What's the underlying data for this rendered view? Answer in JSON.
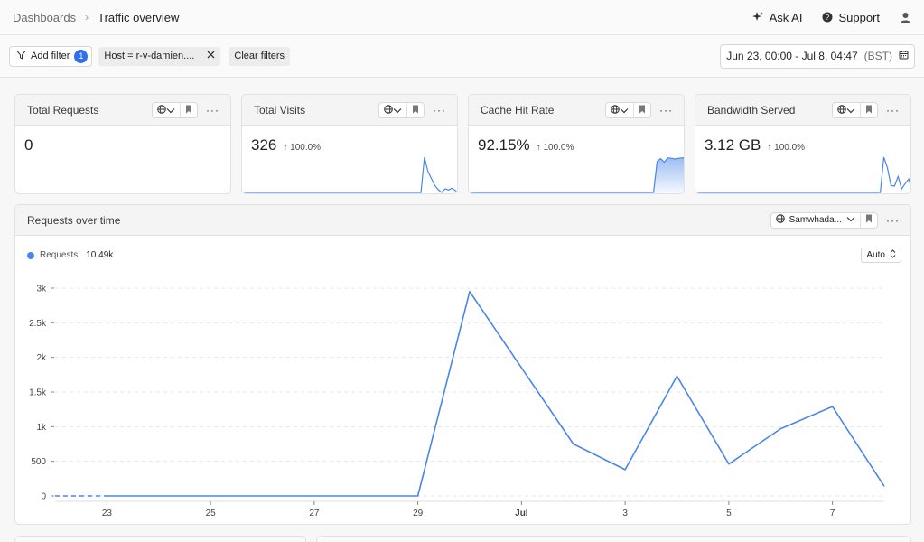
{
  "breadcrumb": {
    "root": "Dashboards",
    "current": "Traffic overview"
  },
  "top_actions": {
    "ask_ai": "Ask AI",
    "support": "Support"
  },
  "filters": {
    "add_filter_label": "Add filter",
    "count": "1",
    "chip": "Host = r-v-damien....",
    "clear_label": "Clear filters",
    "date_range": "Jun 23, 00:00 - Jul 8, 04:47",
    "timezone": "(BST)"
  },
  "kpis": [
    {
      "title": "Total Requests",
      "value": "0",
      "delta": "",
      "spark": []
    },
    {
      "title": "Total Visits",
      "value": "326",
      "delta": "↑ 100.0%",
      "spark": [
        0,
        0,
        0,
        0,
        0,
        0,
        0,
        0,
        0,
        0,
        0,
        0,
        0,
        0,
        0,
        0,
        0,
        0,
        0,
        0,
        0,
        0,
        0,
        0,
        0,
        0,
        0,
        0,
        0,
        0,
        0,
        0,
        0,
        0,
        0,
        0,
        0,
        0,
        0,
        0,
        0,
        0,
        0,
        0,
        0,
        0,
        0,
        0,
        0,
        0,
        0,
        0,
        0,
        1,
        0.6,
        0.4,
        0.2,
        0.08,
        0,
        0.1,
        0.07,
        0.12,
        0.05,
        0
      ]
    },
    {
      "title": "Cache Hit Rate",
      "value": "92.15%",
      "delta": "↑ 100.0%",
      "spark": [
        0,
        0,
        0,
        0,
        0,
        0,
        0,
        0,
        0,
        0,
        0,
        0,
        0,
        0,
        0,
        0,
        0,
        0,
        0,
        0,
        0,
        0,
        0,
        0,
        0,
        0,
        0,
        0,
        0,
        0,
        0,
        0,
        0,
        0,
        0,
        0,
        0,
        0,
        0,
        0,
        0,
        0,
        0,
        0,
        0,
        0,
        0,
        0,
        0,
        0,
        0,
        0,
        0,
        0.88,
        0.96,
        0.86,
        0.98,
        0.97,
        0.95,
        0.97,
        0.98,
        0.99
      ]
    },
    {
      "title": "Bandwidth Served",
      "value": "3.12 GB",
      "delta": "↑ 100.0%",
      "spark": [
        0,
        0,
        0,
        0,
        0,
        0,
        0,
        0,
        0,
        0,
        0,
        0,
        0,
        0,
        0,
        0,
        0,
        0,
        0,
        0,
        0,
        0,
        0,
        0,
        0,
        0,
        0,
        0,
        0,
        0,
        0,
        0,
        0,
        0,
        0,
        0,
        0,
        0,
        0,
        0,
        0,
        0,
        0,
        0,
        0,
        0,
        0,
        0,
        0,
        0,
        0,
        0,
        0,
        1,
        0.7,
        0.2,
        0.18,
        0.45,
        0.1,
        0.25,
        0.38,
        0.05
      ]
    }
  ],
  "main_chart": {
    "title": "Requests over time",
    "host_picker": "Samwhada...",
    "auto_label": "Auto",
    "legend": {
      "name": "Requests",
      "total": "10.49k"
    }
  },
  "chart_data": {
    "type": "line",
    "title": "Requests over time",
    "xlabel": "",
    "ylabel": "",
    "ylim": [
      0,
      3000
    ],
    "yticks": [
      0,
      500,
      1000,
      1500,
      2000,
      2500,
      3000
    ],
    "ytick_labels": [
      "0",
      "500",
      "1k",
      "1.5k",
      "2k",
      "2.5k",
      "3k"
    ],
    "xtick_labels": [
      "23",
      "25",
      "27",
      "29",
      "Jul",
      "3",
      "5",
      "7"
    ],
    "xtick_days": [
      1,
      3,
      5,
      7,
      9,
      11,
      13,
      15
    ],
    "grid": true,
    "series": [
      {
        "name": "Requests",
        "color": "#4a86e8",
        "x": [
          0,
          1,
          2,
          3,
          4,
          5,
          6,
          7,
          8,
          9,
          10,
          11,
          12,
          13,
          14,
          15,
          16
        ],
        "y": [
          0,
          0,
          0,
          0,
          0,
          0,
          0,
          0,
          2950,
          1850,
          750,
          380,
          1730,
          460,
          970,
          1290,
          140
        ]
      }
    ]
  }
}
